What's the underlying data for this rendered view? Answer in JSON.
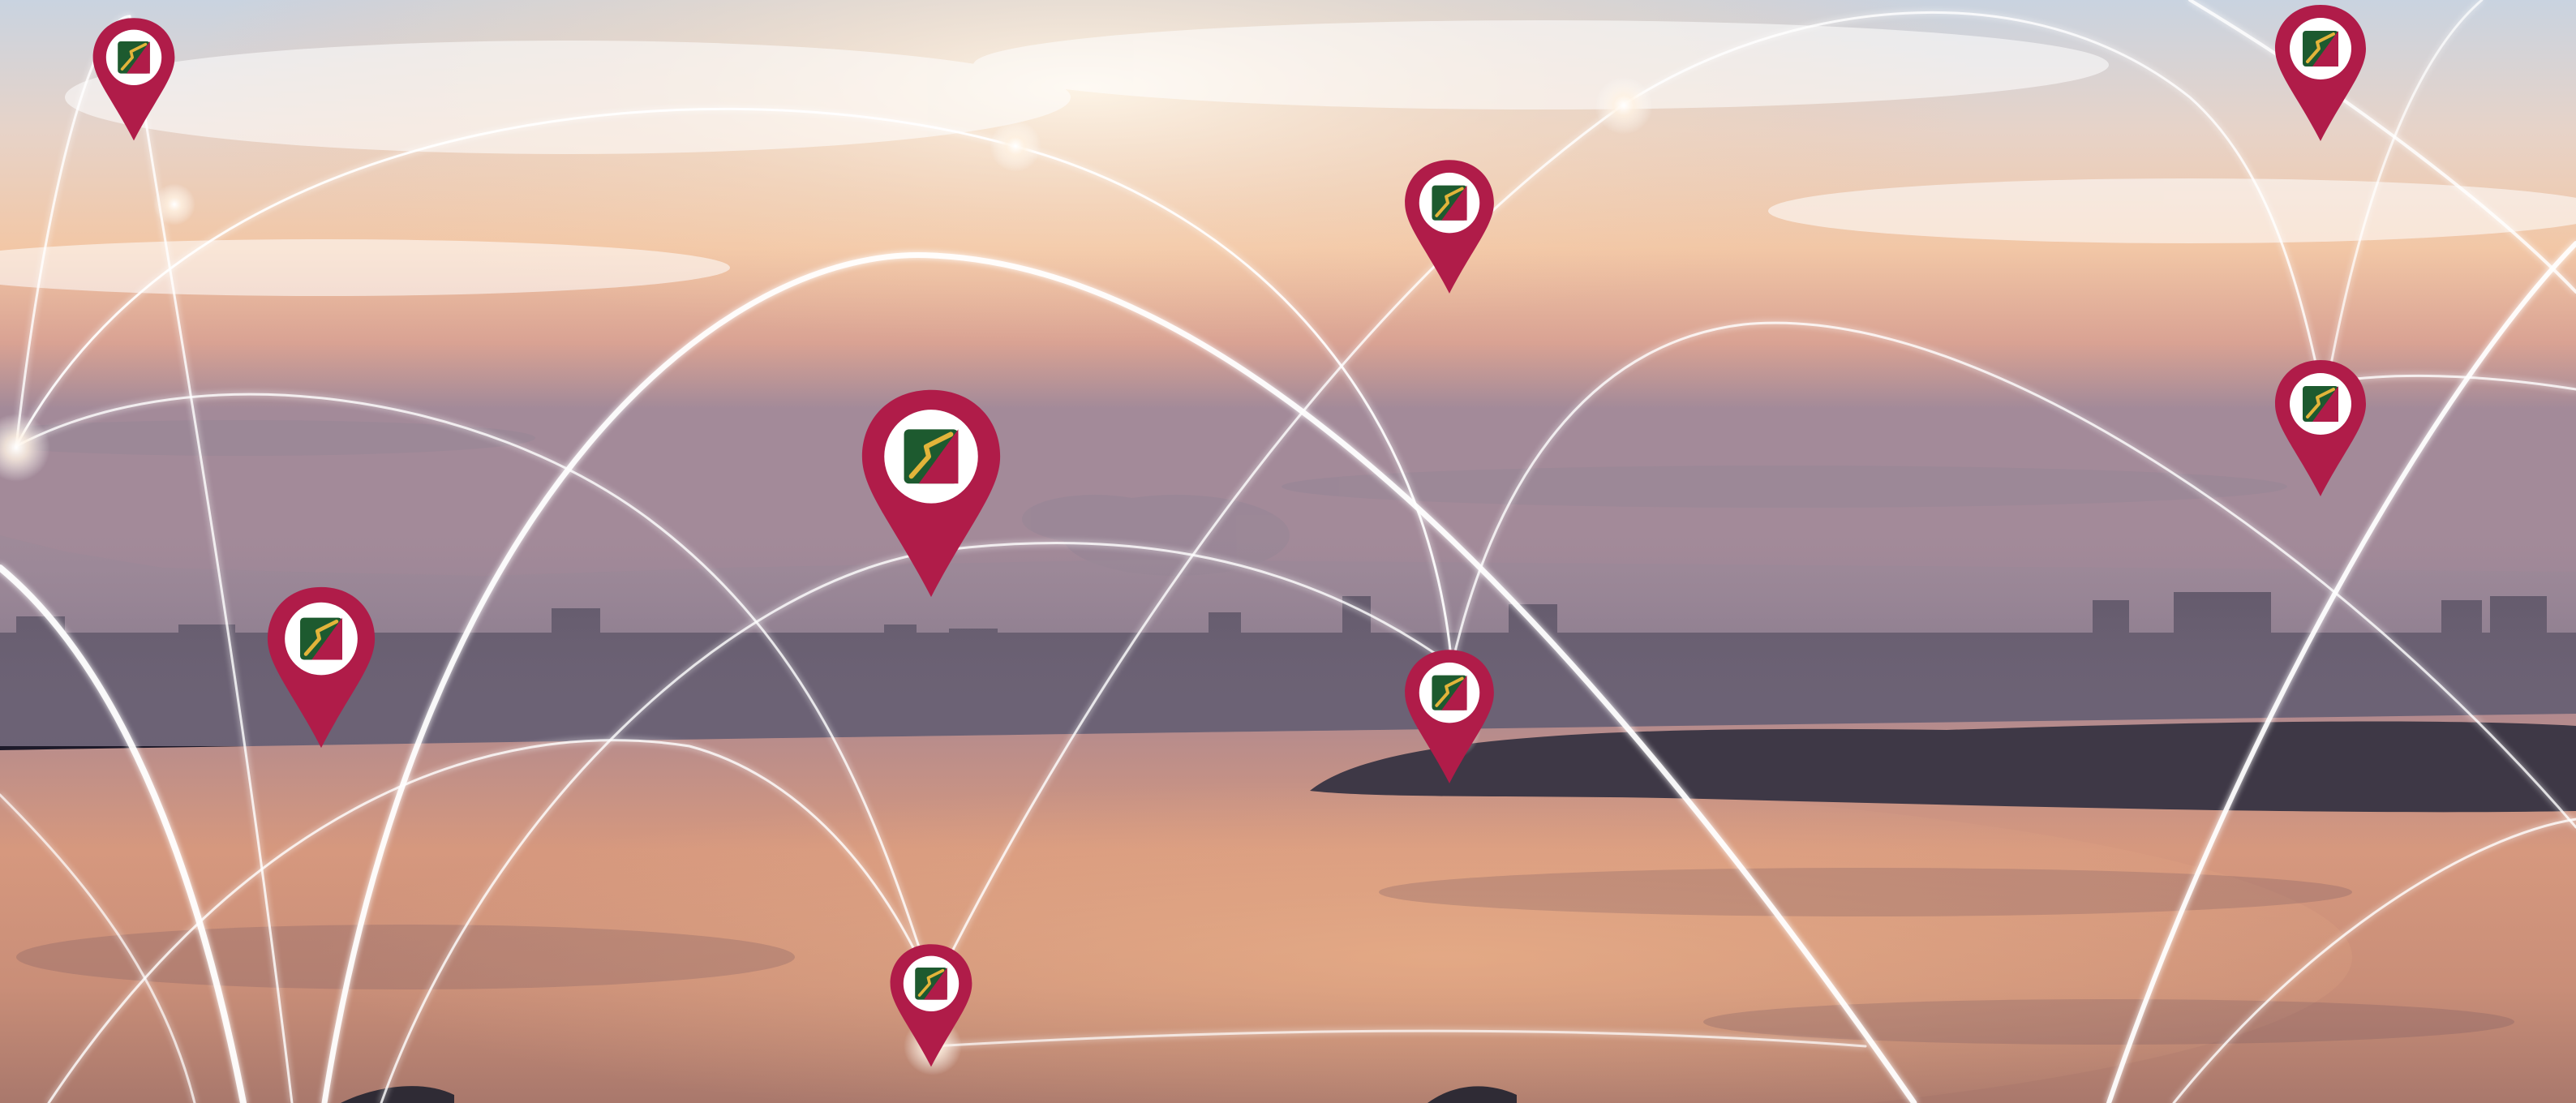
{
  "scene": {
    "description_tag": "",
    "colors": {
      "pin": "#b01c49",
      "pin_dark": "#8e1238",
      "logo_green": "#1d5a2f",
      "logo_red": "#b01c49",
      "logo_gold": "#e2b43a",
      "connection_line": "#ffffff",
      "sky_top": "#cfd7e3",
      "sky_glow": "#f6c9a3",
      "sky_low": "#d79a86",
      "water": "#c98e78",
      "skyline": "#5b5263"
    },
    "pins": [
      {
        "name": "pin-top-left",
        "size": "small"
      },
      {
        "name": "pin-top-center",
        "size": "small"
      },
      {
        "name": "pin-top-right",
        "size": "small"
      },
      {
        "name": "pin-center-large",
        "size": "large"
      },
      {
        "name": "pin-right",
        "size": "small"
      },
      {
        "name": "pin-left-mid",
        "size": "medium"
      },
      {
        "name": "pin-center-island",
        "size": "small"
      },
      {
        "name": "pin-bottom",
        "size": "small"
      }
    ],
    "icon_names": [
      "map-pin-icon",
      "network-arc-icon",
      "glow-node-icon",
      "brand-logo-icon"
    ]
  }
}
